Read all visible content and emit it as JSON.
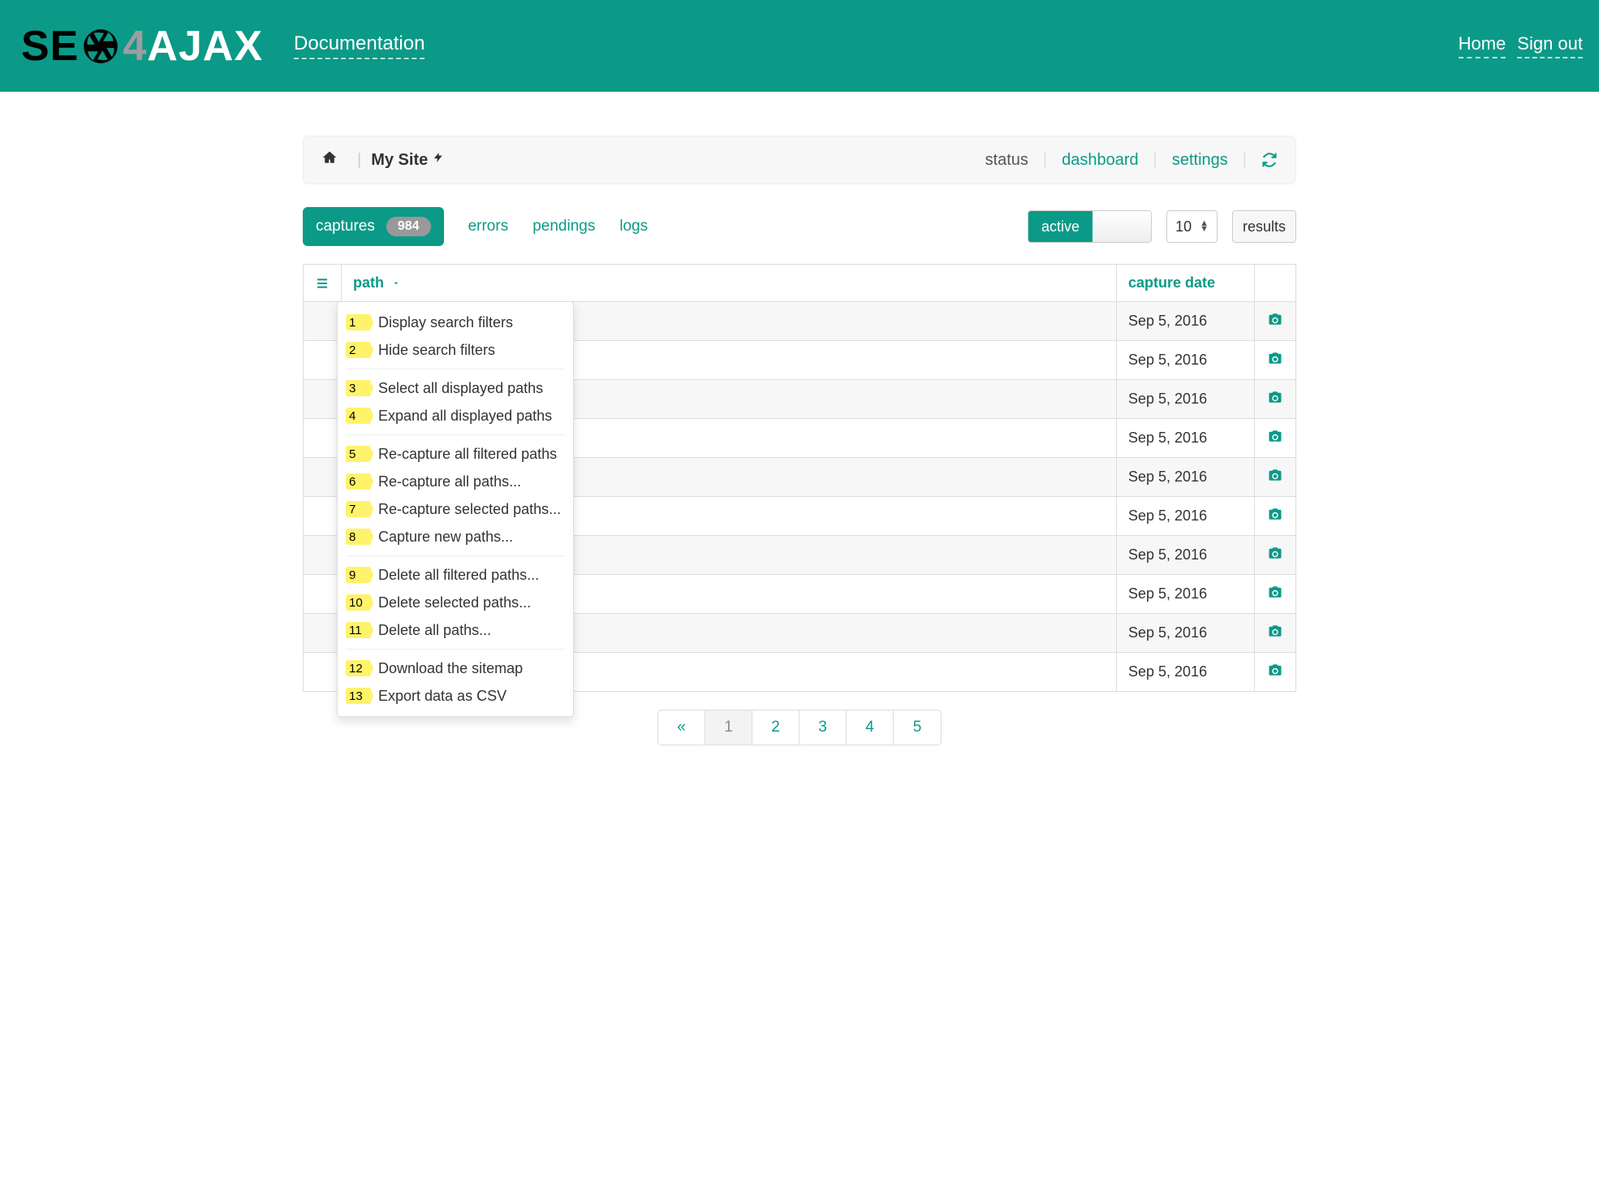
{
  "header": {
    "logo_se": "SE",
    "logo_four": "4",
    "logo_ajax": "AJAX",
    "doc_link": "Documentation",
    "home": "Home",
    "signout": "Sign out"
  },
  "subheader": {
    "site_name": "My Site",
    "status": "status",
    "dashboard": "dashboard",
    "settings": "settings"
  },
  "tabs": {
    "captures": "captures",
    "captures_count": "984",
    "errors": "errors",
    "pendings": "pendings",
    "logs": "logs",
    "active": "active",
    "results_count": "10",
    "results_label": "results"
  },
  "table": {
    "path_header": "path",
    "date_header": "capture date",
    "rows": [
      {
        "date": "Sep 5, 2016"
      },
      {
        "date": "Sep 5, 2016"
      },
      {
        "date": "Sep 5, 2016"
      },
      {
        "date": "Sep 5, 2016"
      },
      {
        "date": "Sep 5, 2016"
      },
      {
        "date": "Sep 5, 2016"
      },
      {
        "date": "Sep 5, 2016"
      },
      {
        "date": "Sep 5, 2016"
      },
      {
        "date": "Sep 5, 2016"
      },
      {
        "date": "Sep 5, 2016"
      }
    ]
  },
  "dropdown": {
    "items": [
      {
        "n": "1",
        "label": "Display search filters"
      },
      {
        "n": "2",
        "label": "Hide search filters"
      },
      {
        "sep": true
      },
      {
        "n": "3",
        "label": "Select all displayed paths"
      },
      {
        "n": "4",
        "label": "Expand all displayed paths"
      },
      {
        "sep": true
      },
      {
        "n": "5",
        "label": "Re-capture all filtered paths"
      },
      {
        "n": "6",
        "label": "Re-capture all paths..."
      },
      {
        "n": "7",
        "label": "Re-capture selected paths..."
      },
      {
        "n": "8",
        "label": "Capture new paths..."
      },
      {
        "sep": true
      },
      {
        "n": "9",
        "label": "Delete all filtered paths..."
      },
      {
        "n": "10",
        "label": "Delete selected paths..."
      },
      {
        "n": "11",
        "label": "Delete all paths..."
      },
      {
        "sep": true
      },
      {
        "n": "12",
        "label": "Download the sitemap"
      },
      {
        "n": "13",
        "label": "Export data as CSV"
      }
    ]
  },
  "pagination": {
    "prev": "«",
    "pages": [
      "1",
      "2",
      "3",
      "4",
      "5"
    ],
    "active": "1"
  }
}
